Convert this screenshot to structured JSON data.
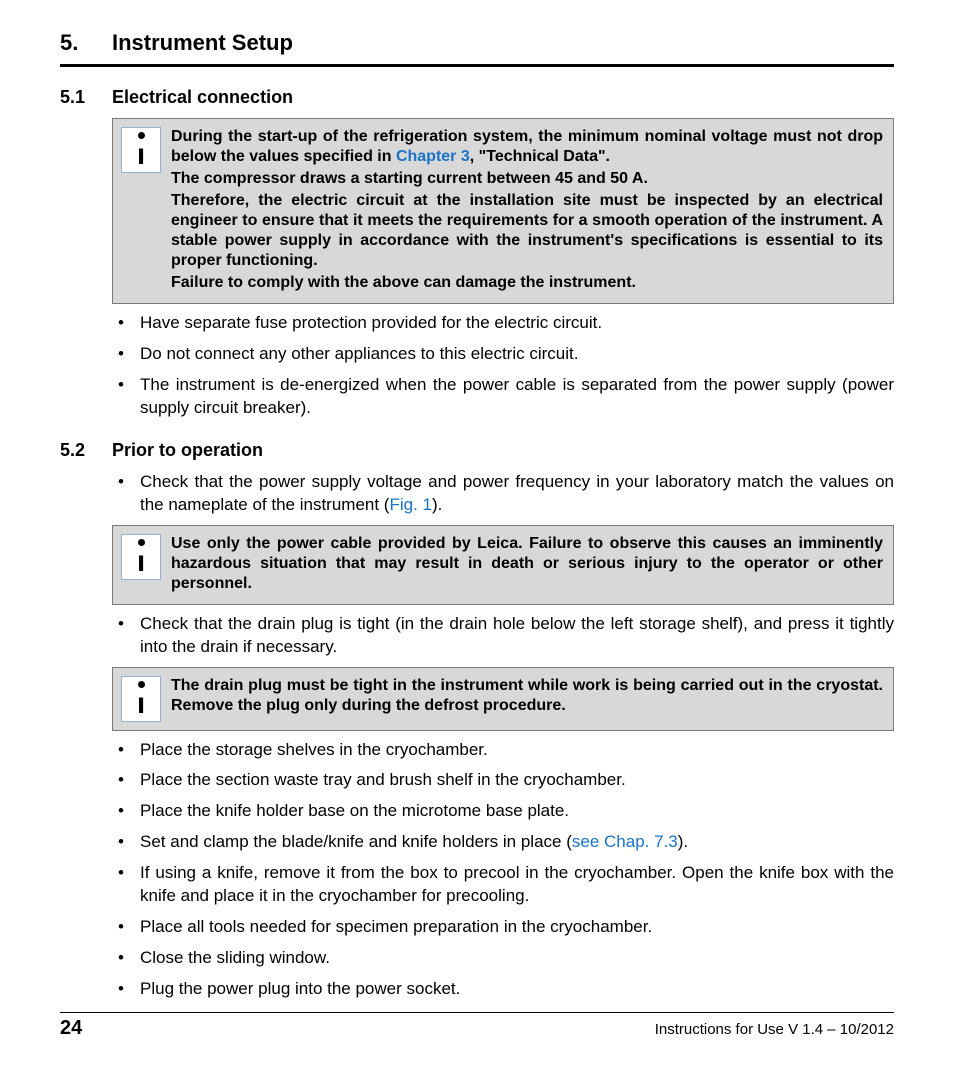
{
  "chapter": {
    "number": "5.",
    "title": "Instrument Setup"
  },
  "sections": {
    "s51": {
      "number": "5.1",
      "title": "Electrical connection"
    },
    "s52": {
      "number": "5.2",
      "title": "Prior to operation"
    }
  },
  "note1": {
    "p1a": "During the start-up of the refrigeration system, the minimum nominal voltage must not drop below the values specified in ",
    "p1link": "Chapter 3",
    "p1b": ", \"Technical Data\".",
    "p2": "The compressor draws a starting current between 45 and 50 A.",
    "p3": "Therefore, the electric circuit at the installation site must be inspected by an electrical engineer to ensure that it meets the requirements for a smooth operation of the instrument. A stable power supply in accordance with the instrument's specifications is essential to its proper functioning.",
    "p4": "Failure to comply with the above can damage the instrument."
  },
  "bullets51": [
    "Have separate fuse protection provided for the electric circuit.",
    "Do not connect any other appliances to this electric circuit.",
    "The instrument is de-energized when the power cable is separated from the power supply (power supply circuit breaker)."
  ],
  "s52_intro_a": "Check that the power supply voltage and power frequency in your laboratory match the values on the nameplate of the instrument (",
  "s52_intro_link": "Fig. 1",
  "s52_intro_b": ").",
  "note2": {
    "p1": "Use only the power cable provided by Leica. Failure to observe this causes an imminently hazardous situation that may result in death or serious injury to the operator or other personnel."
  },
  "bullet_drain": "Check that the drain plug is tight (in the drain hole below the left storage shelf), and press it tightly into the drain if necessary.",
  "note3": {
    "p1": "The drain plug must be tight in the instrument while work is being carried out in the cryostat. Remove the plug only during the defrost procedure."
  },
  "bullets52a": [
    "Place the storage shelves in the cryochamber.",
    "Place the section waste tray and brush shelf in the cryochamber.",
    "Place the knife holder base on the microtome base plate."
  ],
  "bullet_clamp_a": "Set and clamp the blade/knife and knife holders in place (",
  "bullet_clamp_link": "see Chap. 7.3",
  "bullet_clamp_b": ").",
  "bullets52b": [
    "If using a knife, remove it from the box to precool in the cryochamber. Open the knife box with the knife and place it in the cryochamber for precooling.",
    "Place all tools needed for specimen preparation in the cryochamber.",
    "Close the sliding window.",
    "Plug the power plug into the power socket."
  ],
  "footer": {
    "page": "24",
    "text": "Instructions for Use V 1.4 – 10/2012"
  }
}
